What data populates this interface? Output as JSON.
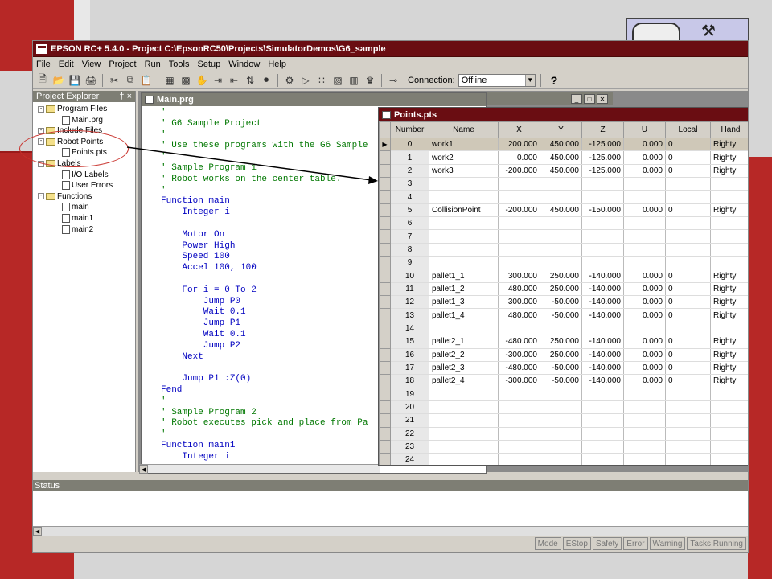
{
  "app": {
    "title": "EPSON RC+ 5.4.0 - Project C:\\EpsonRC50\\Projects\\SimulatorDemos\\G6_sample",
    "menu": [
      "File",
      "Edit",
      "View",
      "Project",
      "Run",
      "Tools",
      "Setup",
      "Window",
      "Help"
    ],
    "toolbar": {
      "connection_label": "Connection:",
      "connection_value": "Offline",
      "help_label": "?"
    }
  },
  "explorer": {
    "title": "Project Explorer",
    "pin": "†",
    "close": "×",
    "nodes": [
      {
        "label": "Program Files",
        "kind": "folder",
        "level": 0
      },
      {
        "label": "Main.prg",
        "kind": "file",
        "level": 1
      },
      {
        "label": "Include Files",
        "kind": "folder",
        "level": 0
      },
      {
        "label": "Robot Points",
        "kind": "folder",
        "level": 0
      },
      {
        "label": "Points.pts",
        "kind": "file",
        "level": 1
      },
      {
        "label": "Labels",
        "kind": "folder",
        "level": 0
      },
      {
        "label": "I/O Labels",
        "kind": "file",
        "level": 1
      },
      {
        "label": "User Errors",
        "kind": "file",
        "level": 1
      },
      {
        "label": "Functions",
        "kind": "folder",
        "level": 0
      },
      {
        "label": "main",
        "kind": "file",
        "level": 1
      },
      {
        "label": "main1",
        "kind": "file",
        "level": 1
      },
      {
        "label": "main2",
        "kind": "file",
        "level": 1
      }
    ]
  },
  "editor": {
    "title": "Main.prg",
    "lines": [
      {
        "t": "'",
        "c": "comment"
      },
      {
        "t": "' G6 Sample Project",
        "c": "comment"
      },
      {
        "t": "'",
        "c": "comment"
      },
      {
        "t": "' Use these programs with the G6 Sample",
        "c": "comment"
      },
      {
        "t": "'",
        "c": "comment"
      },
      {
        "t": "' Sample Program 1",
        "c": "comment"
      },
      {
        "t": "' Robot works on the center table.",
        "c": "comment"
      },
      {
        "t": "'",
        "c": "comment"
      },
      {
        "t": "Function main",
        "c": "kw"
      },
      {
        "t": "    Integer i",
        "c": "kw"
      },
      {
        "t": "",
        "c": "kw"
      },
      {
        "t": "    Motor On",
        "c": "kw"
      },
      {
        "t": "    Power High",
        "c": "kw"
      },
      {
        "t": "    Speed 100",
        "c": "kw"
      },
      {
        "t": "    Accel 100, 100",
        "c": "kw"
      },
      {
        "t": "",
        "c": "kw"
      },
      {
        "t": "    For i = 0 To 2",
        "c": "kw"
      },
      {
        "t": "        Jump P0",
        "c": "kw"
      },
      {
        "t": "        Wait 0.1",
        "c": "kw"
      },
      {
        "t": "        Jump P1",
        "c": "kw"
      },
      {
        "t": "        Wait 0.1",
        "c": "kw"
      },
      {
        "t": "        Jump P2",
        "c": "kw"
      },
      {
        "t": "    Next",
        "c": "kw"
      },
      {
        "t": "",
        "c": "kw"
      },
      {
        "t": "    Jump P1 :Z(0)",
        "c": "kw"
      },
      {
        "t": "Fend",
        "c": "kw"
      },
      {
        "t": "'",
        "c": "comment"
      },
      {
        "t": "' Sample Program 2",
        "c": "comment"
      },
      {
        "t": "' Robot executes pick and place from Pa",
        "c": "comment"
      },
      {
        "t": "'",
        "c": "comment"
      },
      {
        "t": "Function main1",
        "c": "kw"
      },
      {
        "t": "    Integer i",
        "c": "kw"
      }
    ]
  },
  "points": {
    "title": "Points.pts",
    "columns": [
      "Number",
      "Name",
      "X",
      "Y",
      "Z",
      "U",
      "Local",
      "Hand"
    ],
    "rows": [
      [
        "0",
        "work1",
        "200.000",
        "450.000",
        "-125.000",
        "0.000",
        "0",
        "Righty"
      ],
      [
        "1",
        "work2",
        "0.000",
        "450.000",
        "-125.000",
        "0.000",
        "0",
        "Righty"
      ],
      [
        "2",
        "work3",
        "-200.000",
        "450.000",
        "-125.000",
        "0.000",
        "0",
        "Righty"
      ],
      [
        "3",
        "",
        "",
        "",
        "",
        "",
        "",
        ""
      ],
      [
        "4",
        "",
        "",
        "",
        "",
        "",
        "",
        ""
      ],
      [
        "5",
        "CollisionPoint",
        "-200.000",
        "450.000",
        "-150.000",
        "0.000",
        "0",
        "Righty"
      ],
      [
        "6",
        "",
        "",
        "",
        "",
        "",
        "",
        ""
      ],
      [
        "7",
        "",
        "",
        "",
        "",
        "",
        "",
        ""
      ],
      [
        "8",
        "",
        "",
        "",
        "",
        "",
        "",
        ""
      ],
      [
        "9",
        "",
        "",
        "",
        "",
        "",
        "",
        ""
      ],
      [
        "10",
        "pallet1_1",
        "300.000",
        "250.000",
        "-140.000",
        "0.000",
        "0",
        "Righty"
      ],
      [
        "11",
        "pallet1_2",
        "480.000",
        "250.000",
        "-140.000",
        "0.000",
        "0",
        "Righty"
      ],
      [
        "12",
        "pallet1_3",
        "300.000",
        "-50.000",
        "-140.000",
        "0.000",
        "0",
        "Righty"
      ],
      [
        "13",
        "pallet1_4",
        "480.000",
        "-50.000",
        "-140.000",
        "0.000",
        "0",
        "Righty"
      ],
      [
        "14",
        "",
        "",
        "",
        "",
        "",
        "",
        ""
      ],
      [
        "15",
        "pallet2_1",
        "-480.000",
        "250.000",
        "-140.000",
        "0.000",
        "0",
        "Righty"
      ],
      [
        "16",
        "pallet2_2",
        "-300.000",
        "250.000",
        "-140.000",
        "0.000",
        "0",
        "Righty"
      ],
      [
        "17",
        "pallet2_3",
        "-480.000",
        "-50.000",
        "-140.000",
        "0.000",
        "0",
        "Righty"
      ],
      [
        "18",
        "pallet2_4",
        "-300.000",
        "-50.000",
        "-140.000",
        "0.000",
        "0",
        "Righty"
      ],
      [
        "19",
        "",
        "",
        "",
        "",
        "",
        "",
        ""
      ],
      [
        "20",
        "",
        "",
        "",
        "",
        "",
        "",
        ""
      ],
      [
        "21",
        "",
        "",
        "",
        "",
        "",
        "",
        ""
      ],
      [
        "22",
        "",
        "",
        "",
        "",
        "",
        "",
        ""
      ],
      [
        "23",
        "",
        "",
        "",
        "",
        "",
        "",
        ""
      ],
      [
        "24",
        "",
        "",
        "",
        "",
        "",
        "",
        ""
      ]
    ],
    "current_row": 0
  },
  "status": {
    "title": "Status",
    "panels": [
      "Mode",
      "EStop",
      "Safety",
      "Error",
      "Warning",
      "Tasks Running"
    ]
  },
  "colors": {
    "titlebar": "#6a0d12",
    "slide_red": "#b72826",
    "comment": "#007700",
    "keyword": "#0000c0"
  }
}
